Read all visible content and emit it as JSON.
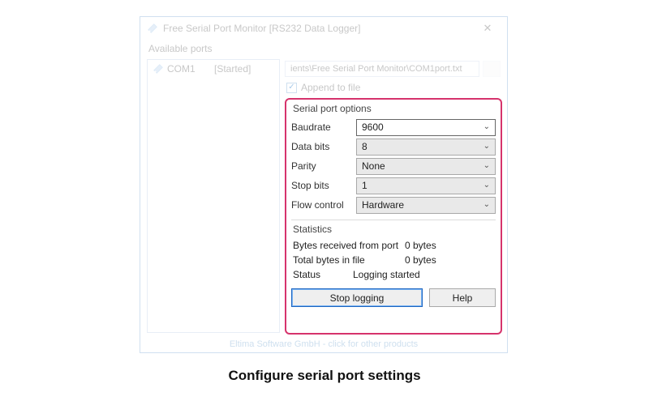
{
  "window": {
    "title": "Free Serial Port Monitor [RS232 Data Logger]"
  },
  "available_ports_label": "Available ports",
  "port": {
    "name": "COM1",
    "status": "[Started]"
  },
  "file": {
    "path_display": "ients\\Free Serial Port Monitor\\COM1port.txt",
    "append_label": "Append to file",
    "append_checked": true
  },
  "options": {
    "title": "Serial port options",
    "rows": {
      "baudrate": {
        "label": "Baudrate",
        "value": "9600"
      },
      "databits": {
        "label": "Data bits",
        "value": "8"
      },
      "parity": {
        "label": "Parity",
        "value": "None"
      },
      "stopbits": {
        "label": "Stop bits",
        "value": "1"
      },
      "flow": {
        "label": "Flow control",
        "value": "Hardware"
      }
    }
  },
  "stats": {
    "title": "Statistics",
    "bytes_received_label": "Bytes received from port",
    "bytes_received_value": "0 bytes",
    "total_bytes_label": "Total bytes in file",
    "total_bytes_value": "0 bytes",
    "status_label": "Status",
    "status_value": "Logging started"
  },
  "buttons": {
    "stop": "Stop logging",
    "help": "Help"
  },
  "footer": "Eltima Software GmbH - click for other products",
  "caption": "Configure serial port settings"
}
